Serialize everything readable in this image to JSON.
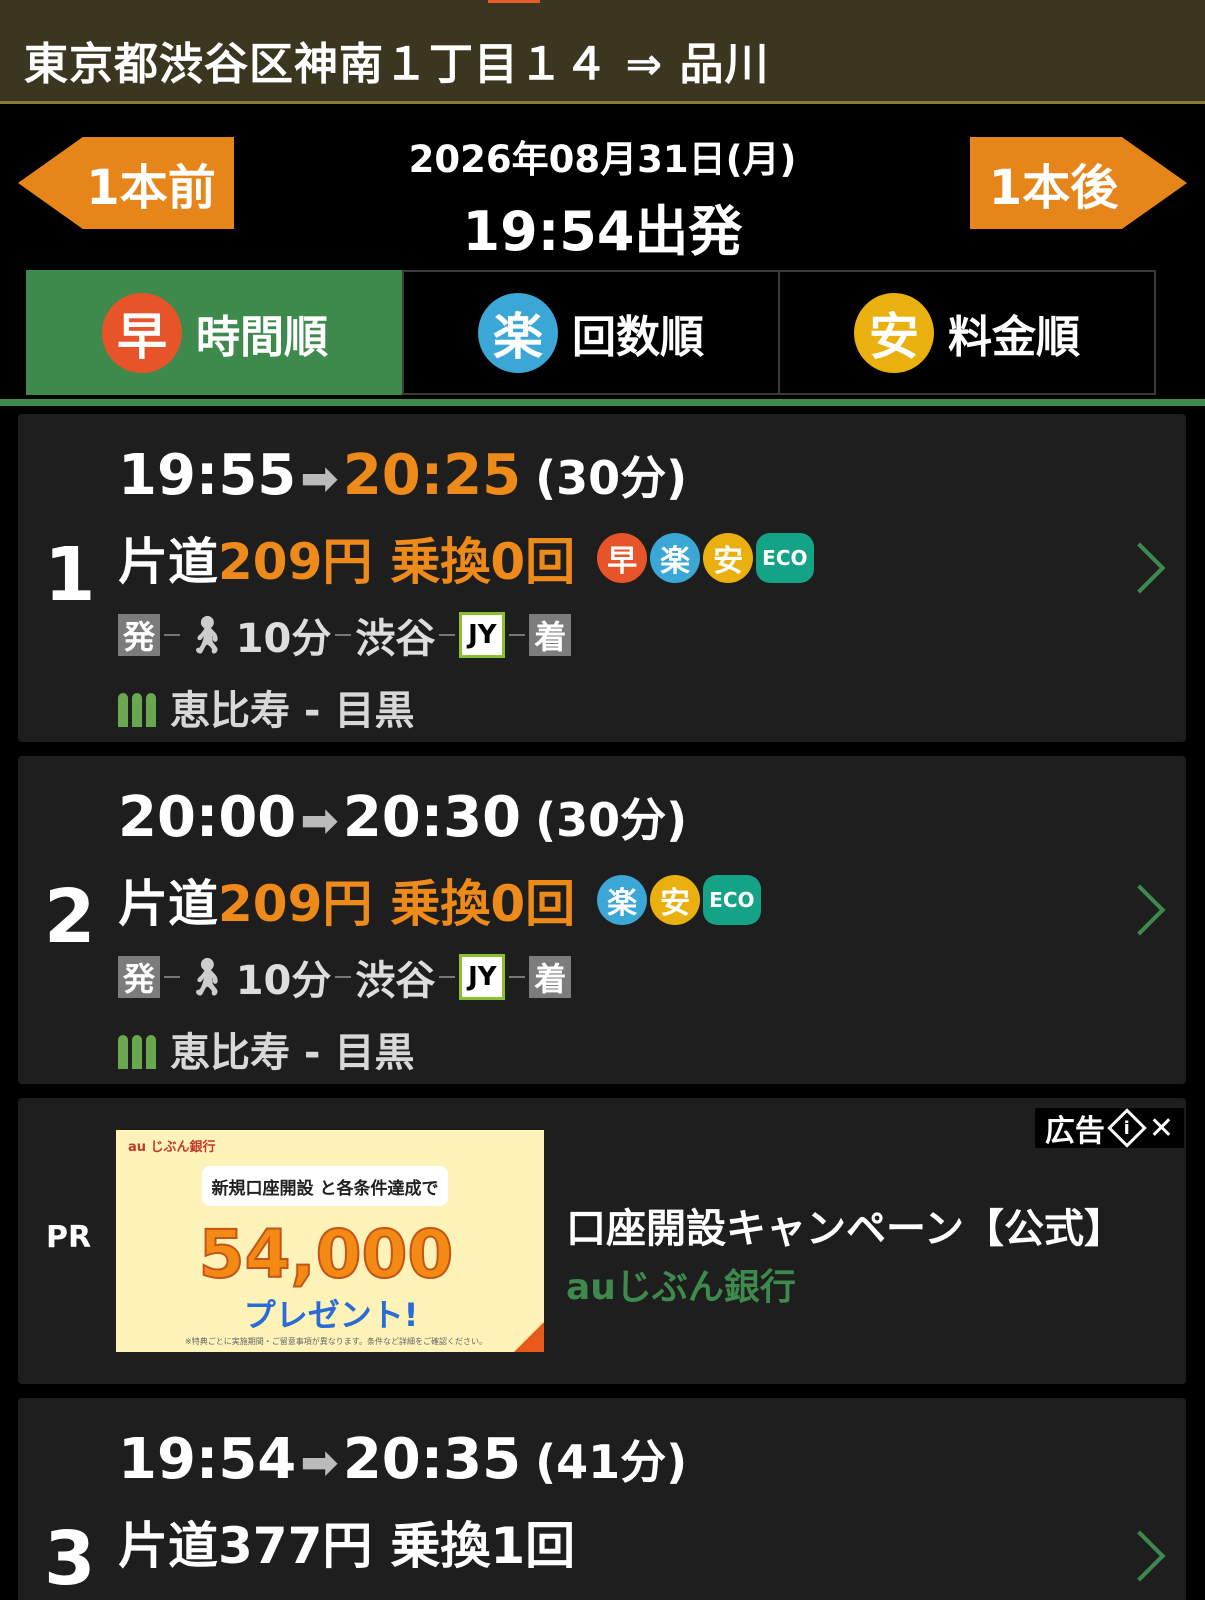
{
  "header": {
    "title": "東京都渋谷区神南１丁目１４ ⇒ 品川"
  },
  "nav": {
    "prev_label": "1本前",
    "next_label": "1本後",
    "date": "2026年08月31日(月)",
    "departure": "19:54出発"
  },
  "tabs": [
    {
      "icon": "早",
      "label": "時間順",
      "icon_color": "#e8542a",
      "active": true
    },
    {
      "icon": "楽",
      "label": "回数順",
      "icon_color": "#3aa7d6",
      "active": false
    },
    {
      "icon": "安",
      "label": "料金順",
      "icon_color": "#eab010",
      "active": false
    }
  ],
  "results": [
    {
      "number": "1",
      "depart": "19:55",
      "arrive": "20:25",
      "duration": "(30分)",
      "fare_prefix": "片道",
      "fare": "209円",
      "transfers": "乗換0回",
      "badges": [
        "早",
        "楽",
        "安"
      ],
      "eco": "ECO",
      "route": {
        "start": "発",
        "walk": "10分",
        "station": "渋谷",
        "line": "JY",
        "end": "着"
      },
      "line_info": "恵比寿 - 目黒"
    },
    {
      "number": "2",
      "depart": "20:00",
      "arrive": "20:30",
      "duration": "(30分)",
      "fare_prefix": "片道",
      "fare": "209円",
      "transfers": "乗換0回",
      "badges": [
        "楽",
        "安"
      ],
      "eco": "ECO",
      "route": {
        "start": "発",
        "walk": "10分",
        "station": "渋谷",
        "line": "JY",
        "end": "着"
      },
      "line_info": "恵比寿 - 目黒"
    },
    {
      "number": "3",
      "depart": "19:54",
      "arrive": "20:35",
      "duration": "(41分)",
      "fare_prefix": "片道",
      "fare": "377円",
      "transfers": "乗換1回"
    }
  ],
  "ad": {
    "pr_label": "PR",
    "ad_label": "広告",
    "headline": "口座開設キャンペーン【公式】",
    "advertiser": "auじぶん銀行",
    "banner": {
      "bank": "au じぶん銀行",
      "bubble": "新規口座開設 と各条件達成で",
      "amount": "54,000",
      "present": "プレゼント!",
      "fine": "※特典ごとに実施期間・ご留意事項が異なります。条件など詳細をご確認ください。"
    }
  },
  "colors": {
    "orange": "#ee8a1a",
    "green": "#3d8a4c",
    "badge_fast": "#e8542a",
    "badge_easy": "#3aa7d6",
    "badge_cheap": "#eab010"
  }
}
